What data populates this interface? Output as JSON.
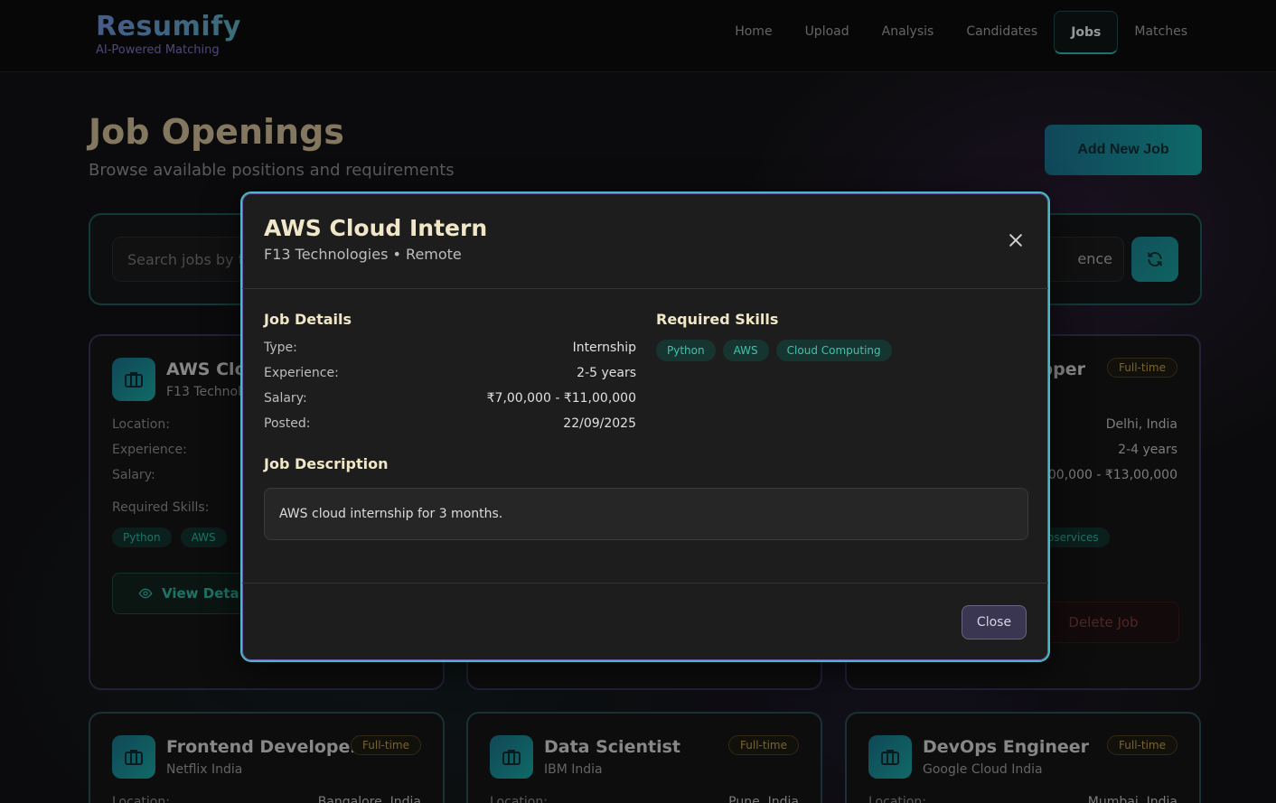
{
  "brand": {
    "title": "Resumify",
    "subtitle": "AI-Powered Matching"
  },
  "nav": {
    "items": [
      "Home",
      "Upload",
      "Analysis",
      "Candidates",
      "Jobs",
      "Matches"
    ],
    "active": "Jobs"
  },
  "header": {
    "title": "Job Openings",
    "subtitle": "Browse available positions and requirements",
    "add_button": "Add New Job"
  },
  "search": {
    "placeholder": "Search jobs by t",
    "experience_select": "ence"
  },
  "cards": [
    {
      "title": "AWS Clo",
      "company": "F13 Technol",
      "labels": {
        "location": "Location:",
        "experience": "Experience:",
        "salary": "Salary:",
        "skills": "Required Skills:"
      },
      "skills": [
        "Python",
        "AWS"
      ],
      "view_button": "View Details"
    },
    {
      "title": "pper",
      "badge": "Full-time",
      "location": "Delhi, India",
      "experience": "2-4 years",
      "salary": ",00,000 - ₹13,00,000",
      "skill_partial": "oservices",
      "delete_button": "Delete Job"
    },
    {
      "title": "Frontend Developer",
      "company": "Netflix India",
      "badge": "Full-time",
      "location_label": "Location:",
      "location": "Bangalore, India"
    },
    {
      "title": "Data Scientist",
      "company": "IBM India",
      "badge": "Full-time",
      "location_label": "Location:",
      "location": "Pune, India"
    },
    {
      "title": "DevOps Engineer",
      "company": "Google Cloud India",
      "badge": "Full-time",
      "location_label": "Location:",
      "location": "Mumbai, India"
    }
  ],
  "modal": {
    "title": "AWS Cloud Intern",
    "subtitle": "F13 Technologies • Remote",
    "details_heading": "Job Details",
    "details": [
      {
        "label": "Type:",
        "value": "Internship"
      },
      {
        "label": "Experience:",
        "value": "2-5 years"
      },
      {
        "label": "Salary:",
        "value": "₹7,00,000 - ₹11,00,000"
      },
      {
        "label": "Posted:",
        "value": "22/09/2025"
      }
    ],
    "skills_heading": "Required Skills",
    "skills": [
      "Python",
      "AWS",
      "Cloud Computing"
    ],
    "description_heading": "Job Description",
    "description": "AWS cloud internship for 3 months.",
    "close_button": "Close"
  }
}
